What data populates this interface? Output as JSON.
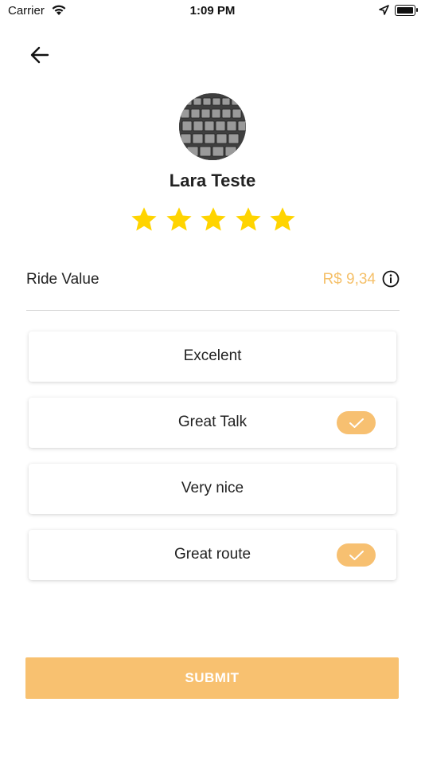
{
  "status_bar": {
    "carrier": "Carrier",
    "time": "1:09 PM",
    "icons": [
      "wifi-icon",
      "location-arrow-icon",
      "battery-icon"
    ]
  },
  "header": {
    "back_icon": "arrow-left-icon"
  },
  "driver": {
    "name": "Lara Teste",
    "avatar": "keyboard-photo",
    "rating": 5,
    "rating_max": 5
  },
  "ride": {
    "label": "Ride Value",
    "value": "R$ 9,34",
    "value_color": "#f5c16b",
    "info_icon": "info-icon"
  },
  "options": [
    {
      "label": "Excelent",
      "selected": false
    },
    {
      "label": "Great Talk",
      "selected": true
    },
    {
      "label": "Very nice",
      "selected": false
    },
    {
      "label": "Great route",
      "selected": true
    }
  ],
  "submit": {
    "label": "SUBMIT",
    "color": "#f8c170"
  },
  "colors": {
    "accent": "#f7c071",
    "star": "#ffd400"
  }
}
